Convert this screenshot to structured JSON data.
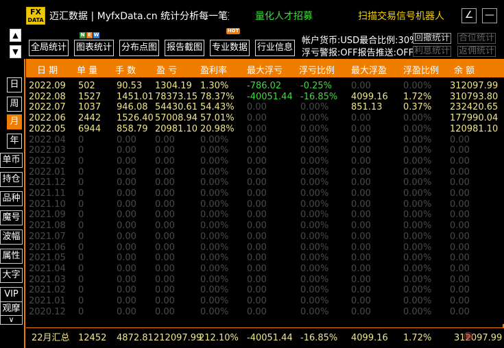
{
  "app": {
    "logo_line1": "FX",
    "logo_line2": "DATA",
    "title": "迈汇数据 | MyfxData.cn  统计分析每一笔交易",
    "recruit": "量化人才招募",
    "scanbot": "扫描交易信号机器人",
    "edit_icon": "∠",
    "min_icon": "—"
  },
  "nav_arrows": {
    "up": "▲",
    "down": "▼"
  },
  "toolbar": {
    "buttons": [
      "全局统计",
      "图表统计",
      "分布点图",
      "报告截图",
      "专业数据",
      "行业信息"
    ],
    "new_badge": [
      "N",
      "E",
      "W"
    ],
    "hot_badge": "HOT",
    "account_line1": "帐户货币:USD",
    "account_line1b": "最合比例:30%",
    "account_line2": "浮亏警报:OFF",
    "account_line2b": "报告推送:OFF",
    "small_buttons": [
      "回撤统计",
      "合位统计",
      "利息统计",
      "返佣统计"
    ]
  },
  "header": [
    "日 期",
    "单 量",
    "手 数",
    "盈 亏",
    "盈利率",
    "最大浮亏",
    "浮亏比例",
    "最大浮盈",
    "浮盈比例",
    "余 额"
  ],
  "period_tabs": [
    "日",
    "周",
    "月",
    "年"
  ],
  "active_period": "月",
  "side_tabs": [
    "单币",
    "持仓",
    "品种",
    "魔号",
    "波幅",
    "属性",
    "大字",
    "VIP",
    "观摩"
  ],
  "side_more": "∨",
  "rows": [
    {
      "date": "2022.09",
      "orders": "502",
      "lots": "90.53",
      "pnl": "1304.19",
      "rate": "1.30%",
      "maxdd": "-786.02",
      "ddpct": "-0.25%",
      "maxfp": "0.00",
      "fppct": "0.00%",
      "balance": "312097.99",
      "state": "active",
      "dd_green": true,
      "fp_dim": true
    },
    {
      "date": "2022.08",
      "orders": "1527",
      "lots": "1451.01",
      "pnl": "78373.15",
      "rate": "78.37%",
      "maxdd": "-40051.44",
      "ddpct": "-16.85%",
      "maxfp": "4099.16",
      "fppct": "1.72%",
      "balance": "310793.80",
      "state": "active",
      "dd_green": true,
      "fp_dim": false
    },
    {
      "date": "2022.07",
      "orders": "1037",
      "lots": "946.08",
      "pnl": "54430.61",
      "rate": "54.43%",
      "maxdd": "0.00",
      "ddpct": "0.00%",
      "maxfp": "851.13",
      "fppct": "0.37%",
      "balance": "232420.65",
      "state": "active",
      "dd_green": false,
      "dd_dim": true,
      "fp_dim": false
    },
    {
      "date": "2022.06",
      "orders": "2442",
      "lots": "1526.40",
      "pnl": "57008.94",
      "rate": "57.01%",
      "maxdd": "0.00",
      "ddpct": "0.00%",
      "maxfp": "0.00",
      "fppct": "0.00%",
      "balance": "177990.04",
      "state": "active",
      "dd_green": false,
      "dd_dim": true,
      "fp_dim": true
    },
    {
      "date": "2022.05",
      "orders": "6944",
      "lots": "858.79",
      "pnl": "20981.10",
      "rate": "20.98%",
      "maxdd": "0.00",
      "ddpct": "0.00%",
      "maxfp": "0.00",
      "fppct": "0.00%",
      "balance": "120981.10",
      "state": "active",
      "dd_green": false,
      "dd_dim": true,
      "fp_dim": true
    },
    {
      "date": "2022.04",
      "orders": "0",
      "lots": "0.00",
      "pnl": "0.00",
      "rate": "0.00%",
      "maxdd": "0.00",
      "ddpct": "0.00%",
      "maxfp": "0.00",
      "fppct": "0.00%",
      "balance": "0.00",
      "state": "dim"
    },
    {
      "date": "2022.03",
      "orders": "0",
      "lots": "0.00",
      "pnl": "0.00",
      "rate": "0.00%",
      "maxdd": "0.00",
      "ddpct": "0.00%",
      "maxfp": "0.00",
      "fppct": "0.00%",
      "balance": "0.00",
      "state": "dim"
    },
    {
      "date": "2022.02",
      "orders": "0",
      "lots": "0.00",
      "pnl": "0.00",
      "rate": "0.00%",
      "maxdd": "0.00",
      "ddpct": "0.00%",
      "maxfp": "0.00",
      "fppct": "0.00%",
      "balance": "0.00",
      "state": "dim"
    },
    {
      "date": "2022.01",
      "orders": "0",
      "lots": "0.00",
      "pnl": "0.00",
      "rate": "0.00%",
      "maxdd": "0.00",
      "ddpct": "0.00%",
      "maxfp": "0.00",
      "fppct": "0.00%",
      "balance": "0.00",
      "state": "dim"
    },
    {
      "date": "2021.12",
      "orders": "0",
      "lots": "0.00",
      "pnl": "0.00",
      "rate": "0.00%",
      "maxdd": "0.00",
      "ddpct": "0.00%",
      "maxfp": "0.00",
      "fppct": "0.00%",
      "balance": "0.00",
      "state": "dim"
    },
    {
      "date": "2021.11",
      "orders": "0",
      "lots": "0.00",
      "pnl": "0.00",
      "rate": "0.00%",
      "maxdd": "0.00",
      "ddpct": "0.00%",
      "maxfp": "0.00",
      "fppct": "0.00%",
      "balance": "0.00",
      "state": "dim"
    },
    {
      "date": "2021.10",
      "orders": "0",
      "lots": "0.00",
      "pnl": "0.00",
      "rate": "0.00%",
      "maxdd": "0.00",
      "ddpct": "0.00%",
      "maxfp": "0.00",
      "fppct": "0.00%",
      "balance": "0.00",
      "state": "dim"
    },
    {
      "date": "2021.09",
      "orders": "0",
      "lots": "0.00",
      "pnl": "0.00",
      "rate": "0.00%",
      "maxdd": "0.00",
      "ddpct": "0.00%",
      "maxfp": "0.00",
      "fppct": "0.00%",
      "balance": "0.00",
      "state": "dim"
    },
    {
      "date": "2021.08",
      "orders": "0",
      "lots": "0.00",
      "pnl": "0.00",
      "rate": "0.00%",
      "maxdd": "0.00",
      "ddpct": "0.00%",
      "maxfp": "0.00",
      "fppct": "0.00%",
      "balance": "0.00",
      "state": "dim"
    },
    {
      "date": "2021.07",
      "orders": "0",
      "lots": "0.00",
      "pnl": "0.00",
      "rate": "0.00%",
      "maxdd": "0.00",
      "ddpct": "0.00%",
      "maxfp": "0.00",
      "fppct": "0.00%",
      "balance": "0.00",
      "state": "dim"
    },
    {
      "date": "2021.06",
      "orders": "0",
      "lots": "0.00",
      "pnl": "0.00",
      "rate": "0.00%",
      "maxdd": "0.00",
      "ddpct": "0.00%",
      "maxfp": "0.00",
      "fppct": "0.00%",
      "balance": "0.00",
      "state": "dim"
    },
    {
      "date": "2021.05",
      "orders": "0",
      "lots": "0.00",
      "pnl": "0.00",
      "rate": "0.00%",
      "maxdd": "0.00",
      "ddpct": "0.00%",
      "maxfp": "0.00",
      "fppct": "0.00%",
      "balance": "0.00",
      "state": "dim"
    },
    {
      "date": "2021.04",
      "orders": "0",
      "lots": "0.00",
      "pnl": "0.00",
      "rate": "0.00%",
      "maxdd": "0.00",
      "ddpct": "0.00%",
      "maxfp": "0.00",
      "fppct": "0.00%",
      "balance": "0.00",
      "state": "dim"
    },
    {
      "date": "2021.03",
      "orders": "0",
      "lots": "0.00",
      "pnl": "0.00",
      "rate": "0.00%",
      "maxdd": "0.00",
      "ddpct": "0.00%",
      "maxfp": "0.00",
      "fppct": "0.00%",
      "balance": "0.00",
      "state": "dim"
    },
    {
      "date": "2021.02",
      "orders": "0",
      "lots": "0.00",
      "pnl": "0.00",
      "rate": "0.00%",
      "maxdd": "0.00",
      "ddpct": "0.00%",
      "maxfp": "0.00",
      "fppct": "0.00%",
      "balance": "0.00",
      "state": "dim"
    },
    {
      "date": "2021.01",
      "orders": "0",
      "lots": "0.00",
      "pnl": "0.00",
      "rate": "0.00%",
      "maxdd": "0.00",
      "ddpct": "0.00%",
      "maxfp": "0.00",
      "fppct": "0.00%",
      "balance": "0.00",
      "state": "dim"
    },
    {
      "date": "2020.12",
      "orders": "0",
      "lots": "0.00",
      "pnl": "0.00",
      "rate": "0.00%",
      "maxdd": "0.00",
      "ddpct": "0.00%",
      "maxfp": "0.00",
      "fppct": "0.00%",
      "balance": "0.00",
      "state": "dim"
    }
  ],
  "footer": {
    "label": "22月汇总",
    "orders": "12452",
    "lots": "4872.81",
    "pnl": "212097.99",
    "rate": "212.10%",
    "maxdd": "-40051.44",
    "ddpct": "-16.85%",
    "maxfp": "4099.16",
    "fppct": "1.72%",
    "balance": "312097.99"
  },
  "colors": {
    "accent": "#f07c00",
    "active_text": "#f0e68c",
    "green_text": "#3ddc3d",
    "dim_text": "#4a4a4a"
  }
}
